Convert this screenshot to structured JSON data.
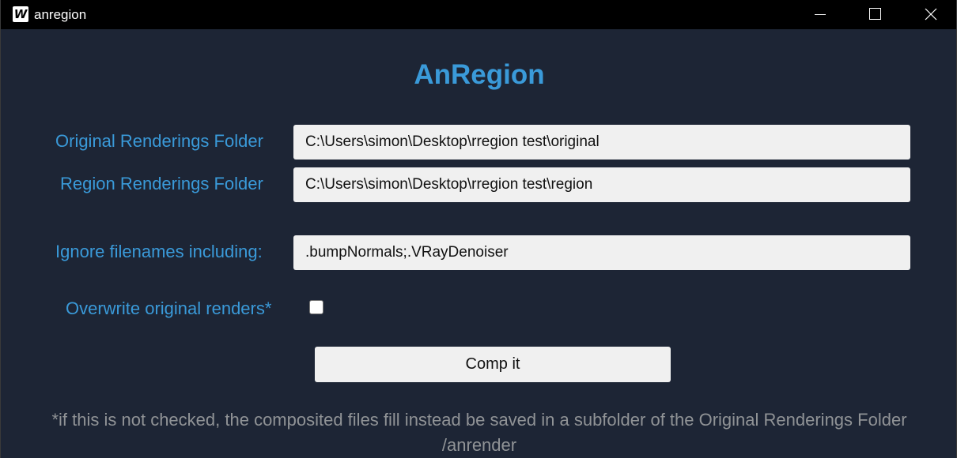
{
  "window": {
    "icon_letter": "W",
    "title": "anregion"
  },
  "icons": {
    "app": "app-logo-icon",
    "minimize": "minimize-icon",
    "maximize": "maximize-icon",
    "close": "close-icon"
  },
  "colors": {
    "background": "#1d2535",
    "titlebar": "#000000",
    "accent": "#3a9ad9",
    "input_bg": "#f0f0f0",
    "footnote": "#909396"
  },
  "main": {
    "title": "AnRegion",
    "fields": {
      "original": {
        "label": "Original Renderings Folder",
        "value": "C:\\Users\\simon\\Desktop\\rregion test\\original"
      },
      "region": {
        "label": "Region Renderings Folder",
        "value": "C:\\Users\\simon\\Desktop\\rregion test\\region"
      },
      "ignore": {
        "label": "Ignore filenames including:",
        "value": ".bumpNormals;.VRayDenoiser"
      }
    },
    "overwrite": {
      "label": "Overwrite original renders*",
      "checked": false
    },
    "button_label": "Comp it",
    "footnote_line1": "*if this is not checked, the composited files fill instead be saved in a subfolder of the Original Renderings Folder",
    "footnote_line2": "/anrender"
  }
}
